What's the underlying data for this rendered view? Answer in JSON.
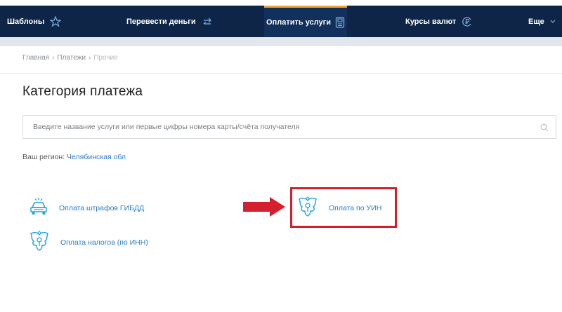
{
  "nav": {
    "templates": "Шаблоны",
    "transfer": "Перевести деньги",
    "pay": "Оплатить услуги",
    "rates": "Курсы валют",
    "more": "Еще"
  },
  "breadcrumb": {
    "home": "Главная",
    "payments": "Платежи",
    "current": "Прочие",
    "separator": "›"
  },
  "title": "Категория платежа",
  "search": {
    "placeholder": "Введите название услуги или первые цифры номера карты/счёта получателя"
  },
  "region": {
    "label": "Ваш регион:",
    "value": "Челябинская обл"
  },
  "services": {
    "gibdd": "Оплата штрафов ГИБДД",
    "tax": "Оплата налогов (по ИНН)",
    "uin": "Оплата по УИН"
  },
  "colors": {
    "nav_bg": "#0f2548",
    "accent_link": "#2a7cc7",
    "highlight": "#d3202e",
    "icon": "#29a6d9"
  }
}
